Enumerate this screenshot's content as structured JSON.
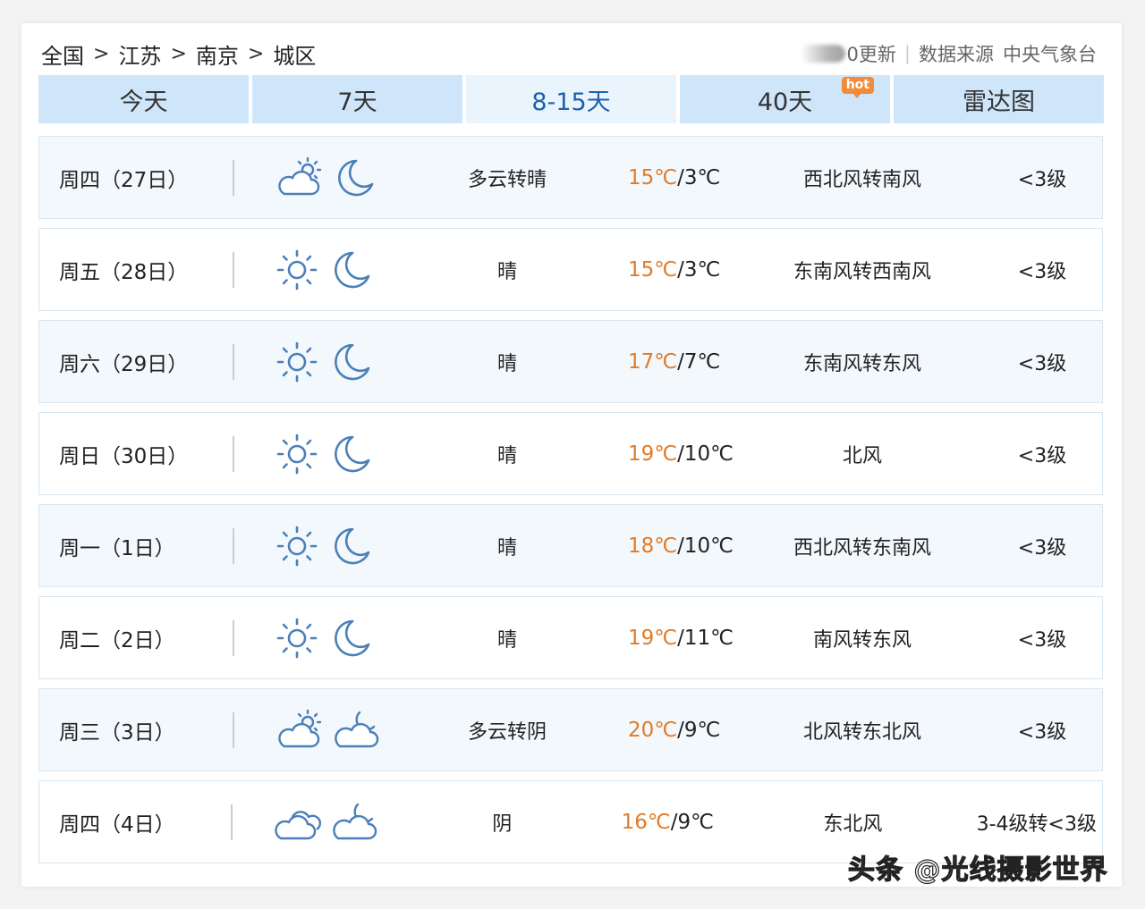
{
  "breadcrumb": [
    "全国",
    "江苏",
    "南京",
    "城区"
  ],
  "breadcrumb_separator": ">",
  "update": {
    "time_suffix": "0更新",
    "source_label": "数据来源",
    "source_name": "中央气象台"
  },
  "tabs": [
    {
      "label": "今天",
      "active": false
    },
    {
      "label": "7天",
      "active": false
    },
    {
      "label": "8-15天",
      "active": true
    },
    {
      "label": "40天",
      "active": false,
      "badge": "hot"
    },
    {
      "label": "雷达图",
      "active": false
    }
  ],
  "forecast": [
    {
      "day": "周四（27日）",
      "day_icon": "partly-cloudy-icon",
      "night_icon": "moon-icon",
      "desc": "多云转晴",
      "high": "15℃",
      "low": "3℃",
      "wind": "西北风转南风",
      "level": "<3级"
    },
    {
      "day": "周五（28日）",
      "day_icon": "sun-icon",
      "night_icon": "moon-icon",
      "desc": "晴",
      "high": "15℃",
      "low": "3℃",
      "wind": "东南风转西南风",
      "level": "<3级"
    },
    {
      "day": "周六（29日）",
      "day_icon": "sun-icon",
      "night_icon": "moon-icon",
      "desc": "晴",
      "high": "17℃",
      "low": "7℃",
      "wind": "东南风转东风",
      "level": "<3级"
    },
    {
      "day": "周日（30日）",
      "day_icon": "sun-icon",
      "night_icon": "moon-icon",
      "desc": "晴",
      "high": "19℃",
      "low": "10℃",
      "wind": "北风",
      "level": "<3级"
    },
    {
      "day": "周一（1日）",
      "day_icon": "sun-icon",
      "night_icon": "moon-icon",
      "desc": "晴",
      "high": "18℃",
      "low": "10℃",
      "wind": "西北风转东南风",
      "level": "<3级"
    },
    {
      "day": "周二（2日）",
      "day_icon": "sun-icon",
      "night_icon": "moon-icon",
      "desc": "晴",
      "high": "19℃",
      "low": "11℃",
      "wind": "南风转东风",
      "level": "<3级"
    },
    {
      "day": "周三（3日）",
      "day_icon": "partly-cloudy-icon",
      "night_icon": "cloudy-night-icon",
      "desc": "多云转阴",
      "high": "20℃",
      "low": "9℃",
      "wind": "北风转东北风",
      "level": "<3级"
    },
    {
      "day": "周四（4日）",
      "day_icon": "overcast-icon",
      "night_icon": "cloudy-night-icon",
      "desc": "阴",
      "high": "16℃",
      "low": "9℃",
      "wind": "东北风",
      "level": "3-4级转<3级"
    }
  ],
  "watermark": "头条 @光线摄影世界",
  "colors": {
    "tab_bg": "#cfe6fa",
    "tab_active_bg": "#eaf4fd",
    "tab_active_text": "#1d60b0",
    "high_temp": "#e07b28",
    "icon_stroke": "#4a7fb8",
    "hot_badge": "#f08c3b"
  }
}
